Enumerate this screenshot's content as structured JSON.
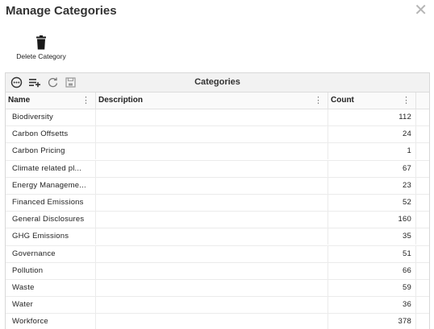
{
  "dialog": {
    "title": "Manage Categories",
    "close_glyph": "✕"
  },
  "toolbar": {
    "delete_label": "Delete Category",
    "delete_icon": "trash-icon"
  },
  "grid": {
    "caption": "Categories",
    "tools": [
      "more-options-icon",
      "add-row-icon",
      "refresh-icon",
      "save-icon"
    ],
    "columns": {
      "name": "Name",
      "description": "Description",
      "count": "Count"
    },
    "rows": [
      {
        "name": "Biodiversity",
        "description": "",
        "count": "112"
      },
      {
        "name": "Carbon Offsetts",
        "description": "",
        "count": "24"
      },
      {
        "name": "Carbon Pricing",
        "description": "",
        "count": "1"
      },
      {
        "name": "Climate related pl...",
        "description": "",
        "count": "67"
      },
      {
        "name": "Energy Manageme...",
        "description": "",
        "count": "23"
      },
      {
        "name": "Financed Emissions",
        "description": "",
        "count": "52"
      },
      {
        "name": "General Disclosures",
        "description": "",
        "count": "160"
      },
      {
        "name": "GHG Emissions",
        "description": "",
        "count": "35"
      },
      {
        "name": "Governance",
        "description": "",
        "count": "51"
      },
      {
        "name": "Pollution",
        "description": "",
        "count": "66"
      },
      {
        "name": "Waste",
        "description": "",
        "count": "59"
      },
      {
        "name": "Water",
        "description": "",
        "count": "36"
      },
      {
        "name": "Workforce",
        "description": "",
        "count": "378"
      }
    ]
  },
  "colors": {
    "header_bg": "#f2f2f2",
    "border": "#d8d8d8",
    "close": "#b5b5b5"
  }
}
